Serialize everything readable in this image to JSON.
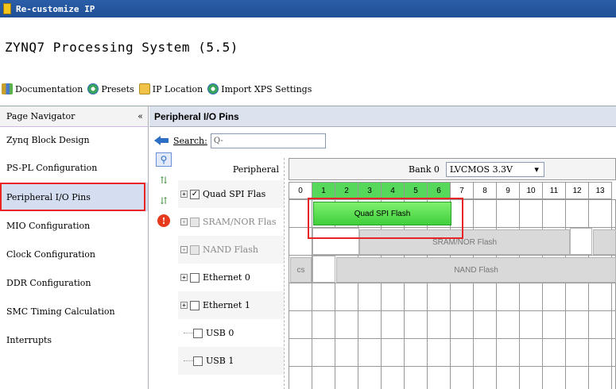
{
  "window": {
    "title": "Re-customize IP"
  },
  "heading": "ZYNQ7 Processing System (5.5)",
  "toolbar": {
    "items": [
      {
        "label": "Documentation",
        "icon": "book-icon"
      },
      {
        "label": "Presets",
        "icon": "gear-icon"
      },
      {
        "label": "IP Location",
        "icon": "folder-icon"
      },
      {
        "label": "Import XPS Settings",
        "icon": "gear-icon"
      }
    ]
  },
  "navigator": {
    "header": "Page Navigator",
    "collapse": "«",
    "items": [
      "Zynq Block Design",
      "PS-PL Configuration",
      "Peripheral I/O Pins",
      "MIO Configuration",
      "Clock Configuration",
      "DDR Configuration",
      "SMC Timing Calculation",
      "Interrupts"
    ],
    "selected_index": 2
  },
  "peripheral": {
    "title": "Peripheral I/O Pins",
    "search_label": "Search:",
    "search_placeholder": "Q-",
    "column_header": "Peripheral",
    "bank_label": "Bank 0",
    "bank_voltage": "LVCMOS 3.3V",
    "pins": [
      "0",
      "1",
      "2",
      "3",
      "4",
      "5",
      "6",
      "7",
      "8",
      "9",
      "10",
      "11",
      "12",
      "13"
    ],
    "rows": [
      {
        "label": "Quad SPI Flas",
        "checked": true,
        "expander": "+"
      },
      {
        "label": "SRAM/NOR Flas",
        "checked": false,
        "disabled": true,
        "expander": "+"
      },
      {
        "label": "NAND Flash",
        "checked": false,
        "disabled": true,
        "expander": "+"
      },
      {
        "label": "Ethernet 0",
        "checked": false,
        "expander": "+"
      },
      {
        "label": "Ethernet 1",
        "checked": false,
        "expander": "+"
      },
      {
        "label": "USB 0",
        "checked": false
      },
      {
        "label": "USB 1",
        "checked": false
      }
    ],
    "blocks": {
      "qspi": "Quad SPI Flash",
      "sram": "SRAM/NOR Flash",
      "nand_cs": "cs",
      "nand": "NAND Flash"
    }
  },
  "colors": {
    "highlight_red": "#e82424",
    "pin_green": "#56d95a",
    "title_blue": "#1f4f96"
  }
}
